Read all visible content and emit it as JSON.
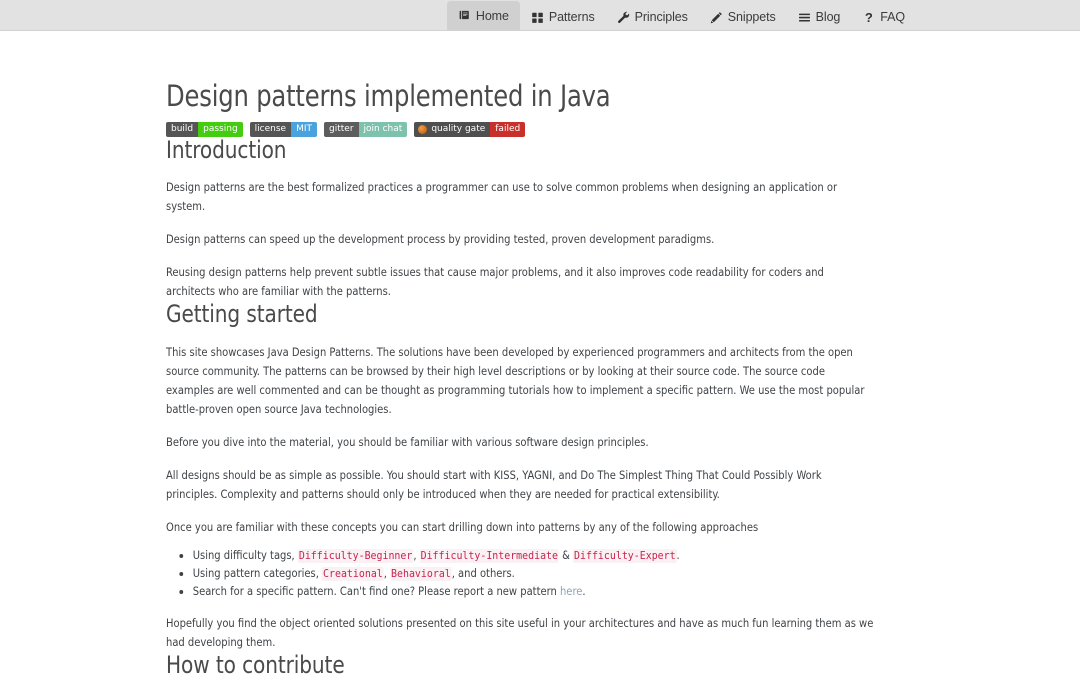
{
  "nav": {
    "items": [
      {
        "label": "Home",
        "icon": "book-icon",
        "active": true
      },
      {
        "label": "Patterns",
        "icon": "grid-icon",
        "active": false
      },
      {
        "label": "Principles",
        "icon": "wrench-icon",
        "active": false
      },
      {
        "label": "Snippets",
        "icon": "pencil-icon",
        "active": false
      },
      {
        "label": "Blog",
        "icon": "bars-icon",
        "active": false
      },
      {
        "label": "FAQ",
        "icon": "question-icon",
        "active": false
      }
    ]
  },
  "page": {
    "title": "Design patterns implemented in Java"
  },
  "badges": [
    {
      "name": "build-badge",
      "left": "build",
      "right": "passing",
      "left_color": "#555555",
      "right_color": "#44cc11"
    },
    {
      "name": "license-badge",
      "left": "license",
      "right": "MIT",
      "left_color": "#555555",
      "right_color": "#4ba3dd"
    },
    {
      "name": "gitter-badge",
      "left": "gitter",
      "right": "join chat",
      "left_color": "#5d5d5d",
      "right_color": "#7ec2ad"
    },
    {
      "name": "quality-gate-badge",
      "left": "quality gate",
      "right": "failed",
      "left_color": "#4f4f4f",
      "right_color": "#c9302c"
    }
  ],
  "sections": {
    "introduction": {
      "heading": "Introduction",
      "paragraphs": [
        "Design patterns are the best formalized practices a programmer can use to solve common problems when designing an application or system.",
        "Design patterns can speed up the development process by providing tested, proven development paradigms.",
        "Reusing design patterns help prevent subtle issues that cause major problems, and it also improves code readability for coders and architects who are familiar with the patterns."
      ]
    },
    "getting_started": {
      "heading": "Getting started",
      "paragraphs": [
        "This site showcases Java Design Patterns. The solutions have been developed by experienced programmers and architects from the open source community. The patterns can be browsed by their high level descriptions or by looking at their source code. The source code examples are well commented and can be thought as programming tutorials how to implement a specific pattern. We use the most popular battle-proven open source Java technologies.",
        "Before you dive into the material, you should be familiar with various software design principles.",
        "All designs should be as simple as possible. You should start with KISS, YAGNI, and Do The Simplest Thing That Could Possibly Work principles. Complexity and patterns should only be introduced when they are needed for practical extensibility.",
        "Once you are familiar with these concepts you can start drilling down into patterns by any of the following approaches"
      ],
      "bullets": {
        "difficulty": {
          "prefix": "Using difficulty tags,",
          "tag1": "Difficulty-Beginner",
          "sep1": ",",
          "tag2": "Difficulty-Intermediate",
          "sep2": "&",
          "tag3": "Difficulty-Expert",
          "suffix": "."
        },
        "categories": {
          "prefix": "Using pattern categories,",
          "tag1": "Creational",
          "sep1": ",",
          "tag2": "Behavioral",
          "suffix": ", and others."
        },
        "search": {
          "prefix": "Search for a specific pattern. Can't find one? Please report a new pattern",
          "link": "here",
          "suffix": "."
        }
      },
      "closing": "Hopefully you find the object oriented solutions presented on this site useful in your architectures and have as much fun learning them as we had developing them."
    },
    "how_to_contribute": {
      "heading": "How to contribute"
    }
  }
}
